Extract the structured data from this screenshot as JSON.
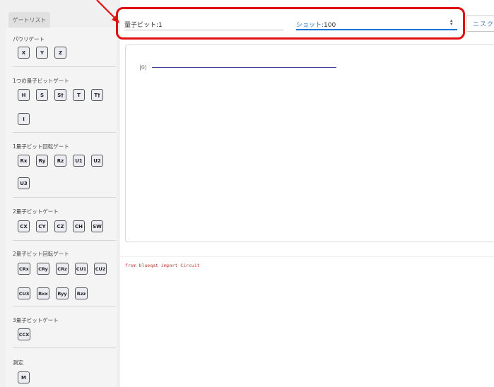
{
  "sidebar": {
    "tab_label": "ゲートリスト",
    "sections": [
      {
        "title": "パウリゲート",
        "rows": [
          [
            "X",
            "Y",
            "Z"
          ]
        ]
      },
      {
        "title": "1つの量子ビットゲート",
        "rows": [
          [
            "H",
            "S",
            "S†",
            "T",
            "T†"
          ],
          [
            "I"
          ]
        ]
      },
      {
        "title": "1量子ビット回転ゲート",
        "rows": [
          [
            "Rx",
            "Ry",
            "Rz",
            "U1",
            "U2"
          ],
          [
            "U3"
          ]
        ]
      },
      {
        "title": "2量子ビットゲート",
        "rows": [
          [
            "CX",
            "CY",
            "CZ",
            "CH",
            "SW"
          ]
        ]
      },
      {
        "title": "2量子ビット回転ゲート",
        "rows": [
          [
            "CRx",
            "CRy",
            "CRz",
            "CU1",
            "CU2"
          ],
          [
            "CU3",
            "Rxx",
            "Ryy",
            "Rzz"
          ]
        ]
      },
      {
        "title": "3量子ビットゲート",
        "rows": [
          [
            "CCX"
          ]
        ]
      },
      {
        "title": "測定",
        "rows": [
          [
            "M"
          ]
        ]
      }
    ]
  },
  "header": {
    "qubits_label": "量子ビット:",
    "qubits_value": "1",
    "shots_label": "ショット:",
    "shots_value": "100",
    "export_label": "ニスク"
  },
  "circuit": {
    "wire_label": "|0⟩"
  },
  "code": {
    "line": "from blueqat import Circuit"
  },
  "colors": {
    "annotation": "#e01010",
    "wire": "#3a3f9c",
    "accent": "#1976d2",
    "code": "#c0392b"
  }
}
